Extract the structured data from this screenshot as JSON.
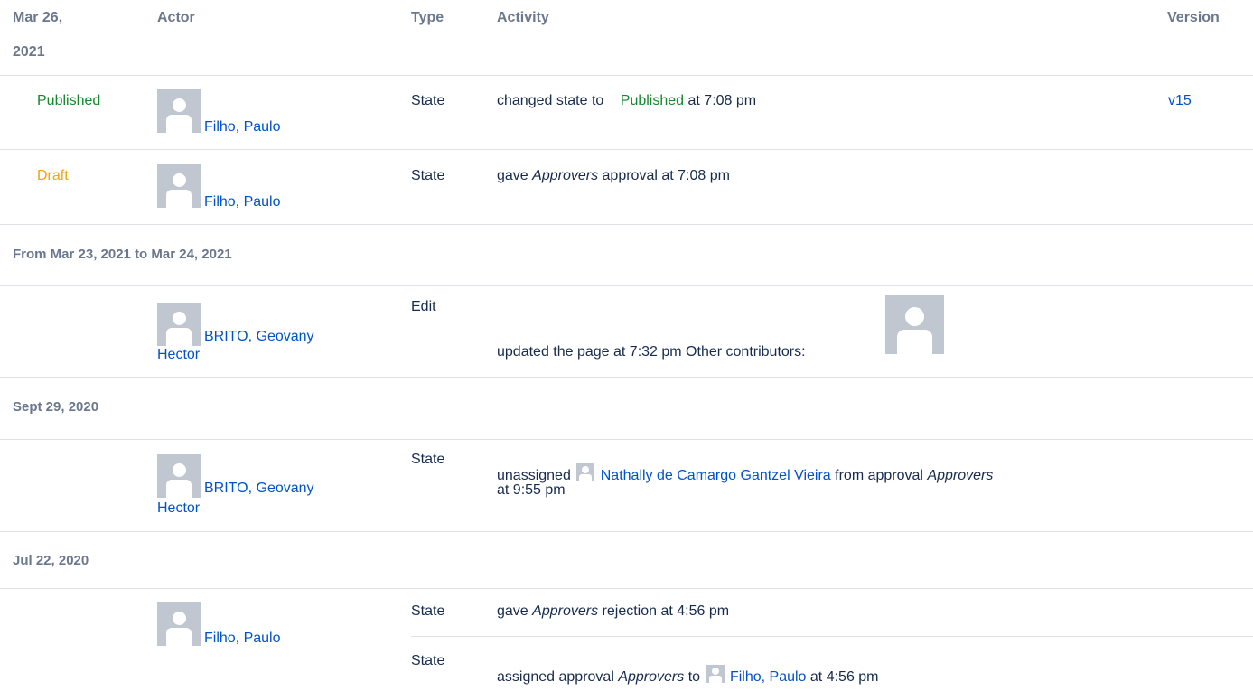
{
  "header": {
    "date_line1": "Mar 26,",
    "date_line2": "2021",
    "actor": "Actor",
    "type": "Type",
    "activity": "Activity",
    "version": "Version"
  },
  "group1": {
    "rows": [
      {
        "status": "Published",
        "actor": "Filho, Paulo",
        "type": "State",
        "activity_pre": "changed state to",
        "activity_status": "Published",
        "activity_post": "at 7:08 pm",
        "version": "v15"
      },
      {
        "status": "Draft",
        "actor": "Filho, Paulo",
        "type": "State",
        "activity_pre": "gave",
        "activity_em": "Approvers",
        "activity_post": "approval at 7:08 pm"
      }
    ]
  },
  "group2": {
    "title": "From Mar 23, 2021 to Mar 24, 2021",
    "row": {
      "actor_line1": "BRITO, Geovany",
      "actor_line2": "Hector",
      "type": "Edit",
      "activity": "updated the page at 7:32 pm Other contributors:"
    }
  },
  "group3": {
    "title": "Sept 29, 2020",
    "row": {
      "actor_line1": "BRITO, Geovany",
      "actor_line2": "Hector",
      "type": "State",
      "activity_pre": "unassigned",
      "activity_user": "Nathally de Camargo Gantzel Vieira",
      "activity_mid": "from approval",
      "activity_em": "Approvers",
      "activity_post": "at 9:55 pm"
    }
  },
  "group4": {
    "title": "Jul 22, 2020",
    "actor": "Filho, Paulo",
    "rows": [
      {
        "type": "State",
        "activity_pre": "gave",
        "activity_em": "Approvers",
        "activity_post": "rejection at 4:56 pm"
      },
      {
        "type": "State",
        "activity_pre": "assigned approval",
        "activity_em": "Approvers",
        "activity_mid": "to",
        "activity_user": "Filho, Paulo",
        "activity_post": "at 4:56 pm"
      }
    ]
  },
  "colors": {
    "link": "#0052cc",
    "published": "#14892c",
    "draft": "#f6a400",
    "header_text": "#6b778c",
    "avatar_bg": "#c1c7d0",
    "divider": "#dfe1e6"
  },
  "icons": {
    "avatar": "default-user-avatar-icon"
  }
}
